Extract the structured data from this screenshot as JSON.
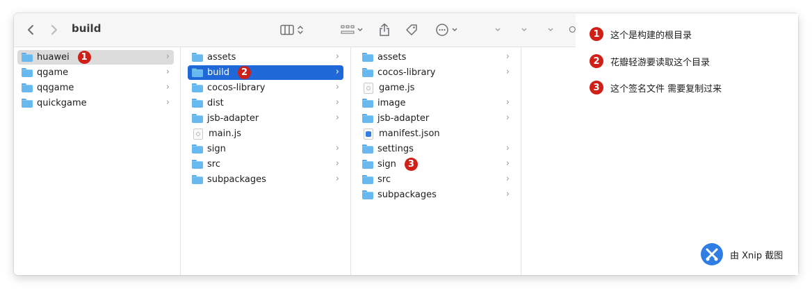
{
  "toolbar": {
    "title": "build",
    "back_icon": "chevron-left-icon",
    "forward_icon": "chevron-right-icon",
    "view_icon": "column-view-icon",
    "group_icon": "grid-icon",
    "share_icon": "share-icon",
    "tag_icon": "tag-icon",
    "more_icon": "ellipsis-circle-icon"
  },
  "columns": [
    {
      "items": [
        {
          "label": "huawei",
          "type": "folder",
          "has_children": true,
          "selected": "gray",
          "badge": "1"
        },
        {
          "label": "qgame",
          "type": "folder",
          "has_children": true
        },
        {
          "label": "qqgame",
          "type": "folder",
          "has_children": true
        },
        {
          "label": "quickgame",
          "type": "folder",
          "has_children": true
        }
      ]
    },
    {
      "items": [
        {
          "label": "assets",
          "type": "folder",
          "has_children": true
        },
        {
          "label": "build",
          "type": "folder",
          "has_children": true,
          "selected": "blue",
          "badge": "2"
        },
        {
          "label": "cocos-library",
          "type": "folder",
          "has_children": true
        },
        {
          "label": "dist",
          "type": "folder",
          "has_children": true
        },
        {
          "label": "jsb-adapter",
          "type": "folder",
          "has_children": true
        },
        {
          "label": "main.js",
          "type": "js",
          "has_children": false
        },
        {
          "label": "sign",
          "type": "folder",
          "has_children": true
        },
        {
          "label": "src",
          "type": "folder",
          "has_children": true
        },
        {
          "label": "subpackages",
          "type": "folder",
          "has_children": true
        }
      ]
    },
    {
      "items": [
        {
          "label": "assets",
          "type": "folder",
          "has_children": true
        },
        {
          "label": "cocos-library",
          "type": "folder",
          "has_children": true
        },
        {
          "label": "game.js",
          "type": "js",
          "has_children": false
        },
        {
          "label": "image",
          "type": "folder",
          "has_children": true
        },
        {
          "label": "jsb-adapter",
          "type": "folder",
          "has_children": true
        },
        {
          "label": "manifest.json",
          "type": "json",
          "has_children": false
        },
        {
          "label": "settings",
          "type": "folder",
          "has_children": true
        },
        {
          "label": "sign",
          "type": "folder",
          "has_children": true,
          "badge": "3"
        },
        {
          "label": "src",
          "type": "folder",
          "has_children": true
        },
        {
          "label": "subpackages",
          "type": "folder",
          "has_children": true
        }
      ]
    }
  ],
  "legend": [
    {
      "badge": "1",
      "text": "这个是构建的根目录"
    },
    {
      "badge": "2",
      "text": "花瓣轻游要读取这个目录"
    },
    {
      "badge": "3",
      "text": "这个签名文件 需要复制过来"
    }
  ],
  "watermark": {
    "text": "由 Xnip 截图"
  },
  "colors": {
    "badge": "#cf1f17",
    "selection": "#1e68d8",
    "folder": "#67b9f0"
  }
}
